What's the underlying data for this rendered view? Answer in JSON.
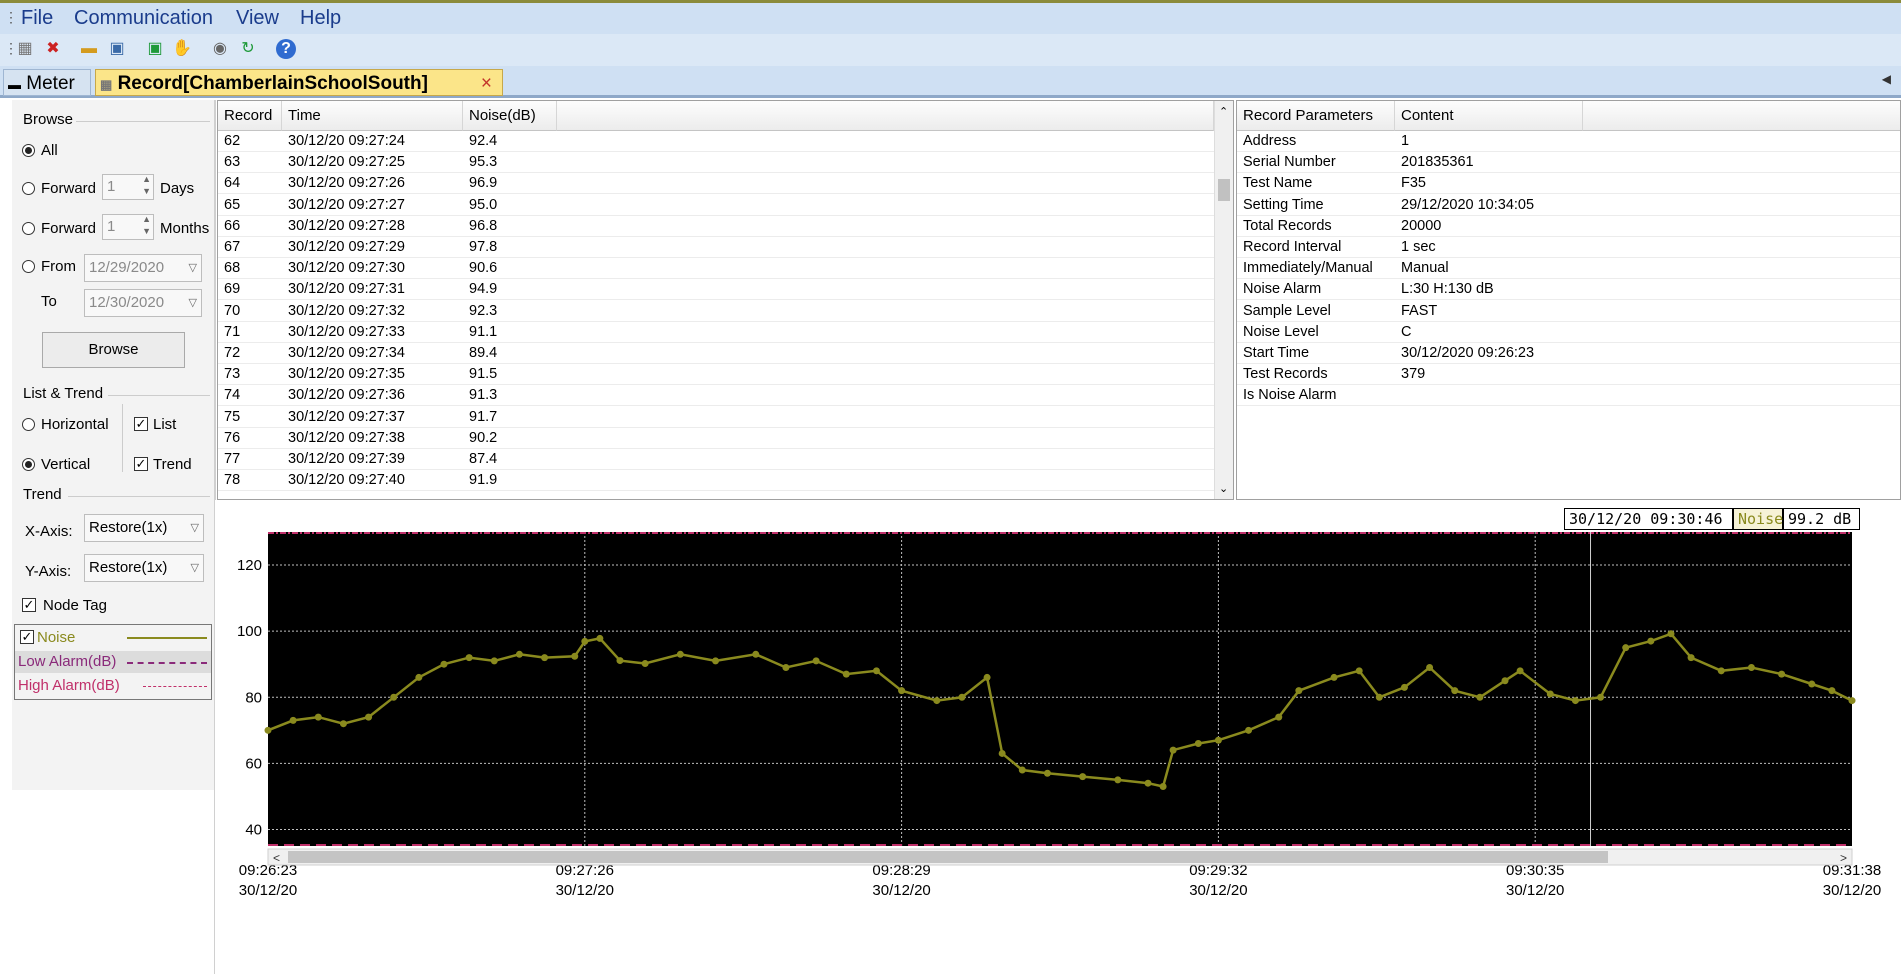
{
  "menu": [
    "File",
    "Communication",
    "View",
    "Help"
  ],
  "toolbar_icons": [
    "new-record-icon",
    "delete-record-icon",
    "open-folder-icon",
    "save-icon",
    "export-icon",
    "import-icon",
    "settings-icon",
    "refresh-icon",
    "help-icon"
  ],
  "tabs": {
    "meter": "Meter",
    "record": "Record[ChamberlainSchoolSouth]",
    "close": "×"
  },
  "left": {
    "browse_group": "Browse",
    "all": "All",
    "forward_days_label": "Forward",
    "forward_days_value": "1",
    "days": "Days",
    "forward_months_label": "Forward",
    "forward_months_value": "1",
    "months": "Months",
    "from": "From",
    "from_date": "12/29/2020",
    "to": "To",
    "to_date": "12/30/2020",
    "browse_button": "Browse",
    "list_trend_group": "List & Trend",
    "horizontal": "Horizontal",
    "vertical": "Vertical",
    "list": "List",
    "trend": "Trend",
    "trend_group": "Trend",
    "xaxis_label": "X-Axis:",
    "xaxis_value": "Restore(1x)",
    "yaxis_label": "Y-Axis:",
    "yaxis_value": "Restore(1x)",
    "node_tag": "Node Tag",
    "legend": {
      "noise": "Noise",
      "low_alarm": "Low Alarm(dB)",
      "high_alarm": "High Alarm(dB)"
    }
  },
  "records_table": {
    "headers": [
      "Record",
      "Time",
      "Noise(dB)"
    ],
    "rows": [
      [
        "62",
        "30/12/20 09:27:24",
        "92.4"
      ],
      [
        "63",
        "30/12/20 09:27:25",
        "95.3"
      ],
      [
        "64",
        "30/12/20 09:27:26",
        "96.9"
      ],
      [
        "65",
        "30/12/20 09:27:27",
        "95.0"
      ],
      [
        "66",
        "30/12/20 09:27:28",
        "96.8"
      ],
      [
        "67",
        "30/12/20 09:27:29",
        "97.8"
      ],
      [
        "68",
        "30/12/20 09:27:30",
        "90.6"
      ],
      [
        "69",
        "30/12/20 09:27:31",
        "94.9"
      ],
      [
        "70",
        "30/12/20 09:27:32",
        "92.3"
      ],
      [
        "71",
        "30/12/20 09:27:33",
        "91.1"
      ],
      [
        "72",
        "30/12/20 09:27:34",
        "89.4"
      ],
      [
        "73",
        "30/12/20 09:27:35",
        "91.5"
      ],
      [
        "74",
        "30/12/20 09:27:36",
        "91.3"
      ],
      [
        "75",
        "30/12/20 09:27:37",
        "91.7"
      ],
      [
        "76",
        "30/12/20 09:27:38",
        "90.2"
      ],
      [
        "77",
        "30/12/20 09:27:39",
        "87.4"
      ],
      [
        "78",
        "30/12/20 09:27:40",
        "91.9"
      ]
    ]
  },
  "params_table": {
    "headers": [
      "Record Parameters",
      "Content"
    ],
    "rows": [
      [
        "Address",
        "1"
      ],
      [
        "Serial Number",
        "201835361"
      ],
      [
        "Test Name",
        "F35"
      ],
      [
        "Setting Time",
        "29/12/2020 10:34:05"
      ],
      [
        "Total Records",
        "20000"
      ],
      [
        "Record Interval",
        "1 sec"
      ],
      [
        "Immediately/Manual",
        "Manual"
      ],
      [
        "Noise Alarm",
        "L:30 H:130 dB"
      ],
      [
        "Sample Level",
        "FAST"
      ],
      [
        "Noise Level",
        "C"
      ],
      [
        "Start Time",
        "30/12/2020 09:26:23"
      ],
      [
        "Test Records",
        "379"
      ],
      [
        "Is Noise Alarm",
        ""
      ]
    ]
  },
  "cursor_readout": {
    "time": "30/12/20 09:30:46",
    "series": "Noise",
    "value": "99.2 dB"
  },
  "colors": {
    "series": "#8a8a1e",
    "alarm": "#c0306a",
    "plot_bg": "#000000",
    "grid": "#bfbfbf"
  },
  "chart_data": {
    "type": "line",
    "ylim": [
      35,
      130
    ],
    "yticks": [
      40,
      60,
      80,
      100,
      120
    ],
    "x_labels": [
      {
        "time": "09:26:23",
        "date": "30/12/20"
      },
      {
        "time": "09:27:26",
        "date": "30/12/20"
      },
      {
        "time": "09:28:29",
        "date": "30/12/20"
      },
      {
        "time": "09:29:32",
        "date": "30/12/20"
      },
      {
        "time": "09:30:35",
        "date": "30/12/20"
      },
      {
        "time": "09:31:38",
        "date": "30/12/20"
      }
    ],
    "x_range_seconds_from": "09:26:23",
    "low_alarm": 30,
    "high_alarm": 130,
    "series": [
      {
        "name": "Noise",
        "points": [
          [
            "09:26:23",
            70
          ],
          [
            "09:26:28",
            73
          ],
          [
            "09:26:33",
            74
          ],
          [
            "09:26:38",
            72
          ],
          [
            "09:26:43",
            74
          ],
          [
            "09:26:48",
            80
          ],
          [
            "09:26:53",
            86
          ],
          [
            "09:26:58",
            90
          ],
          [
            "09:27:03",
            92
          ],
          [
            "09:27:08",
            91
          ],
          [
            "09:27:13",
            93
          ],
          [
            "09:27:18",
            92
          ],
          [
            "09:27:24",
            92.4
          ],
          [
            "09:27:26",
            96.9
          ],
          [
            "09:27:29",
            97.8
          ],
          [
            "09:27:33",
            91.1
          ],
          [
            "09:27:38",
            90.2
          ],
          [
            "09:27:45",
            93
          ],
          [
            "09:27:52",
            91
          ],
          [
            "09:28:00",
            93
          ],
          [
            "09:28:06",
            89
          ],
          [
            "09:28:12",
            91
          ],
          [
            "09:28:18",
            87
          ],
          [
            "09:28:24",
            88
          ],
          [
            "09:28:29",
            82
          ],
          [
            "09:28:36",
            79
          ],
          [
            "09:28:41",
            80
          ],
          [
            "09:28:46",
            86
          ],
          [
            "09:28:49",
            63
          ],
          [
            "09:28:53",
            58
          ],
          [
            "09:28:58",
            57
          ],
          [
            "09:29:05",
            56
          ],
          [
            "09:29:12",
            55
          ],
          [
            "09:29:18",
            54
          ],
          [
            "09:29:21",
            53
          ],
          [
            "09:29:23",
            64
          ],
          [
            "09:29:28",
            66
          ],
          [
            "09:29:32",
            67
          ],
          [
            "09:29:38",
            70
          ],
          [
            "09:29:44",
            74
          ],
          [
            "09:29:48",
            82
          ],
          [
            "09:29:55",
            86
          ],
          [
            "09:30:00",
            88
          ],
          [
            "09:30:04",
            80
          ],
          [
            "09:30:09",
            83
          ],
          [
            "09:30:14",
            89
          ],
          [
            "09:30:19",
            82
          ],
          [
            "09:30:24",
            80
          ],
          [
            "09:30:29",
            85
          ],
          [
            "09:30:32",
            88
          ],
          [
            "09:30:38",
            81
          ],
          [
            "09:30:43",
            79
          ],
          [
            "09:30:48",
            80
          ],
          [
            "09:30:53",
            95
          ],
          [
            "09:30:58",
            97
          ],
          [
            "09:31:02",
            99.2
          ],
          [
            "09:31:06",
            92
          ],
          [
            "09:31:12",
            88
          ],
          [
            "09:31:18",
            89
          ],
          [
            "09:31:24",
            87
          ],
          [
            "09:31:30",
            84
          ],
          [
            "09:31:34",
            82
          ],
          [
            "09:31:38",
            79
          ]
        ]
      }
    ]
  }
}
